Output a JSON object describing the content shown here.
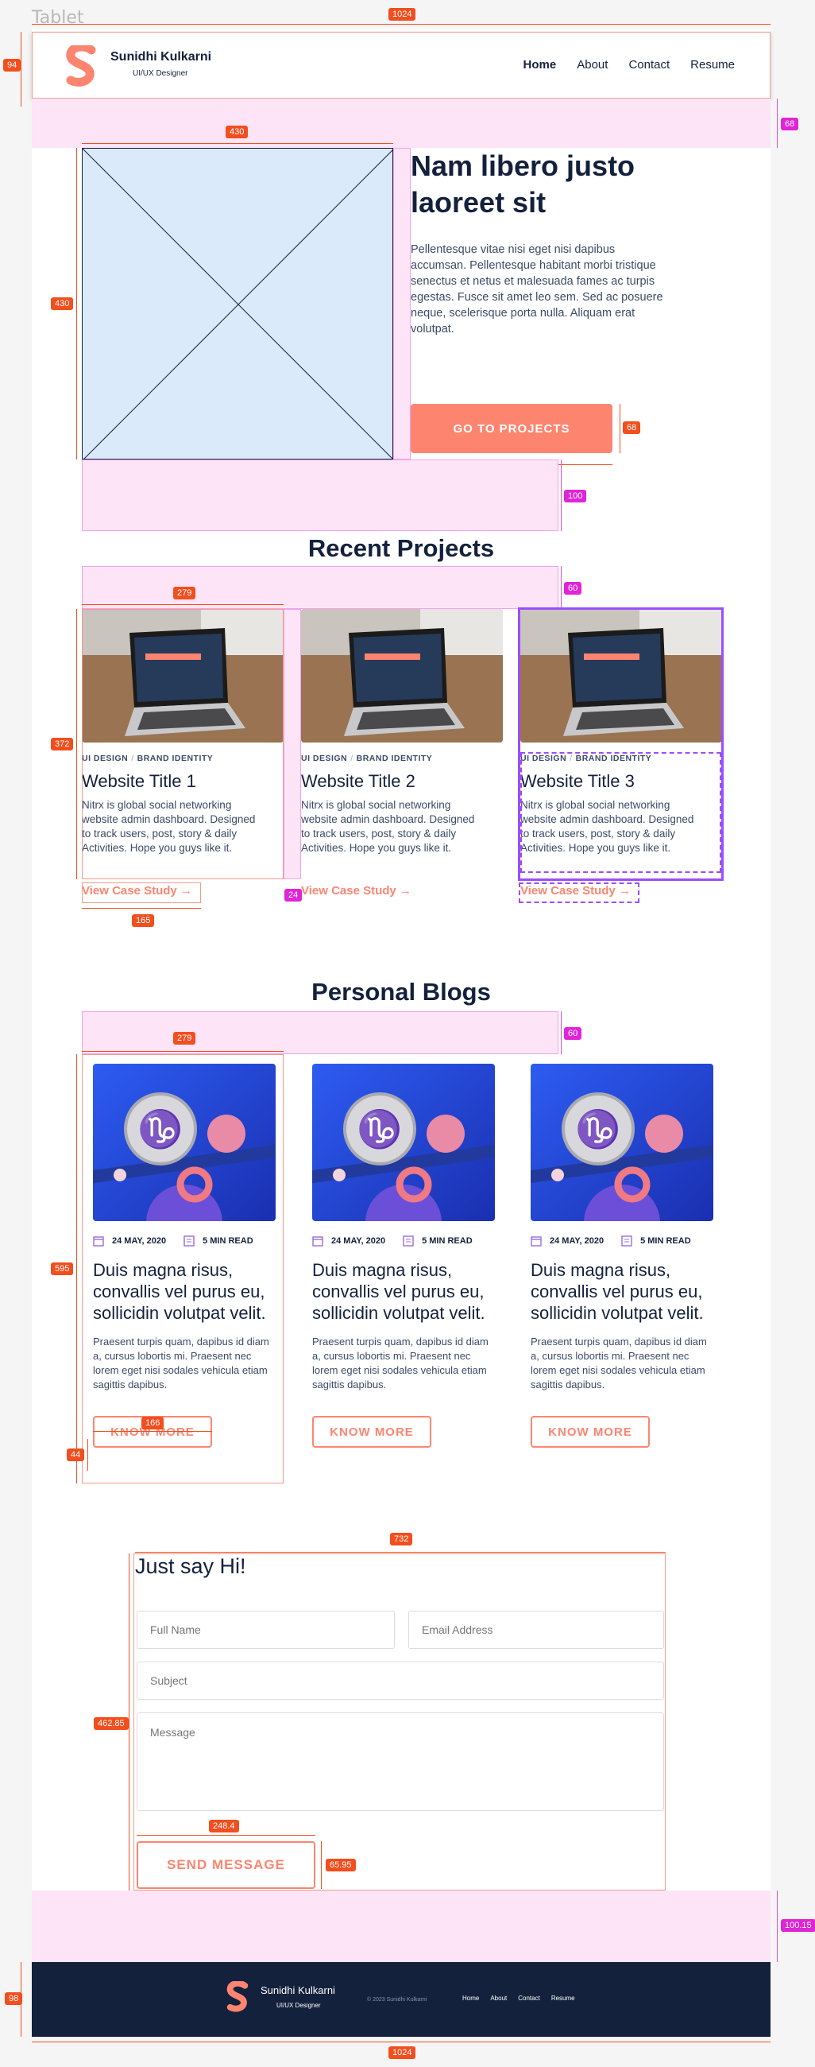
{
  "canvas": {
    "label": "Tablet"
  },
  "header": {
    "brand_name": "Sunidhi Kulkarni",
    "brand_role": "UI/UX Designer",
    "nav": [
      {
        "label": "Home",
        "active": true
      },
      {
        "label": "About",
        "active": false
      },
      {
        "label": "Contact",
        "active": false
      },
      {
        "label": "Resume",
        "active": false
      }
    ]
  },
  "hero": {
    "title": "Nam libero justo laoreet sit",
    "text": "Pellentesque vitae nisi eget nisi dapibus accumsan. Pellentesque habitant morbi tristique senectus et netus et malesuada fames ac turpis egestas. Fusce sit amet leo sem. Sed ac posuere neque, scelerisque porta nulla. Aliquam erat volutpat.",
    "button": "GO TO PROJECTS"
  },
  "projects": {
    "title": "Recent Projects",
    "items": [
      {
        "tag1": "UI DESIGN",
        "tag2": "BRAND IDENTITY",
        "title": "Website Title 1",
        "desc": "Nitrx is global social networking website admin dashboard. Designed to track users, post, story & daily Activities. Hope you guys like it.",
        "link": "View Case Study"
      },
      {
        "tag1": "UI DESIGN",
        "tag2": "BRAND IDENTITY",
        "title": "Website Title 2",
        "desc": "Nitrx is global social networking website admin dashboard. Designed to track users, post, story & daily Activities. Hope you guys like it.",
        "link": "View Case Study"
      },
      {
        "tag1": "UI DESIGN",
        "tag2": "BRAND IDENTITY",
        "title": "Website Title 3",
        "desc": "Nitrx is global social networking website admin dashboard. Designed to track users, post, story & daily Activities. Hope you guys like it.",
        "link": "View Case Study"
      }
    ]
  },
  "blogs": {
    "title": "Personal Blogs",
    "items": [
      {
        "date": "24 MAY, 2020",
        "read": "5 MIN READ",
        "title": "Duis magna risus, convallis vel purus eu, sollicidin volutpat velit.",
        "desc": "Praesent turpis quam, dapibus id diam a, cursus lobortis mi. Praesent nec lorem eget nisi sodales vehicula etiam sagittis dapibus.",
        "button": "KNOW MORE"
      },
      {
        "date": "24 MAY, 2020",
        "read": "5 MIN READ",
        "title": "Duis magna risus, convallis vel purus eu, sollicidin volutpat velit.",
        "desc": "Praesent turpis quam, dapibus id diam a, cursus lobortis mi. Praesent nec lorem eget nisi sodales vehicula etiam sagittis dapibus.",
        "button": "KNOW MORE"
      },
      {
        "date": "24 MAY, 2020",
        "read": "5 MIN READ",
        "title": "Duis magna risus, convallis vel purus eu, sollicidin volutpat velit.",
        "desc": "Praesent turpis quam, dapibus id diam a, cursus lobortis mi. Praesent nec lorem eget nisi sodales vehicula etiam sagittis dapibus.",
        "button": "KNOW MORE"
      }
    ]
  },
  "contact": {
    "title": "Just say Hi!",
    "full_name_placeholder": "Full Name",
    "email_placeholder": "Email Address",
    "subject_placeholder": "Subject",
    "message_placeholder": "Message",
    "button": "SEND MESSAGE"
  },
  "footer": {
    "brand_name": "Sunidhi Kulkarni",
    "brand_role": "UI/UX Designer",
    "copyright": "© 2023 Sunidhi Kulkarni",
    "nav": [
      "Home",
      "About",
      "Contact",
      "Resume"
    ]
  },
  "annotations": {
    "frame_width": "1024",
    "header_height": "94",
    "band_top": "68",
    "hero_img_width": "430",
    "hero_img_height": "430",
    "hero_gap": "24",
    "hero_col": "279",
    "hero_btn_h": "68",
    "hero_bottom_space": "100",
    "proj_title_space": "60",
    "proj_col": "279",
    "proj_card_h": "372",
    "proj_gap": "24",
    "proj_link_w": "165",
    "blog_title_space": "60",
    "blog_col": "279",
    "blog_card_h": "595",
    "blog_btn_w": "166",
    "blog_btn_h": "44",
    "contact_w": "732",
    "contact_h": "462.85",
    "send_w": "248.4",
    "send_h": "65.95",
    "footer_space": "100.15",
    "footer_h": "98",
    "bottom_width": "1024"
  },
  "colors": {
    "accent": "#fd8570",
    "navy": "#14213d",
    "band": "#fde4f7",
    "measure": "#f24e1e",
    "select": "#9b4dff"
  }
}
